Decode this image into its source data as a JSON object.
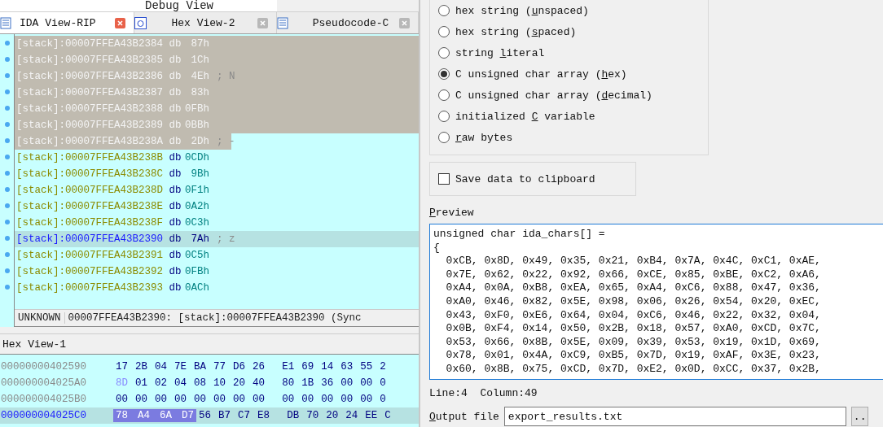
{
  "top_tab": {
    "label": "Debug View"
  },
  "tabs": [
    {
      "label": "IDA View-RIP",
      "selected": true
    },
    {
      "label": "Hex View-2",
      "selected": false
    },
    {
      "label": "Pseudocode-C",
      "selected": false
    }
  ],
  "disassembly": {
    "rows": [
      {
        "address": "[stack]:00007FFEA43B2384",
        "mnemonic": "db",
        "value": "87h",
        "selected": true,
        "current": false
      },
      {
        "address": "[stack]:00007FFEA43B2385",
        "mnemonic": "db",
        "value": "1Ch",
        "selected": true,
        "current": false
      },
      {
        "address": "[stack]:00007FFEA43B2386",
        "mnemonic": "db",
        "value": "4Eh",
        "comment": "; N",
        "comment_selected": true,
        "selected": true,
        "current": false
      },
      {
        "address": "[stack]:00007FFEA43B2387",
        "mnemonic": "db",
        "value": "83h",
        "selected": true,
        "current": false
      },
      {
        "address": "[stack]:00007FFEA43B2388",
        "mnemonic": "db",
        "value": "0FBh",
        "selected": true,
        "current": false
      },
      {
        "address": "[stack]:00007FFEA43B2389",
        "mnemonic": "db",
        "value": "0BBh",
        "selected": true,
        "current": false
      },
      {
        "address": "[stack]:00007FFEA43B238A",
        "mnemonic": "db",
        "value": "2Dh",
        "comment": "; -",
        "comment_selected": false,
        "selected": true,
        "current": false
      },
      {
        "address": "[stack]:00007FFEA43B238B",
        "mnemonic": "db",
        "value": "0CDh",
        "selected": false,
        "current": false
      },
      {
        "address": "[stack]:00007FFEA43B238C",
        "mnemonic": "db",
        "value": "9Bh",
        "selected": false,
        "current": false
      },
      {
        "address": "[stack]:00007FFEA43B238D",
        "mnemonic": "db",
        "value": "0F1h",
        "selected": false,
        "current": false
      },
      {
        "address": "[stack]:00007FFEA43B238E",
        "mnemonic": "db",
        "value": "0A2h",
        "selected": false,
        "current": false
      },
      {
        "address": "[stack]:00007FFEA43B238F",
        "mnemonic": "db",
        "value": "0C3h",
        "selected": false,
        "current": false
      },
      {
        "address": "[stack]:00007FFEA43B2390",
        "mnemonic": "db",
        "value": "7Ah",
        "comment": "; z",
        "selected": false,
        "current": true
      },
      {
        "address": "[stack]:00007FFEA43B2391",
        "mnemonic": "db",
        "value": "0C5h",
        "selected": false,
        "current": false
      },
      {
        "address": "[stack]:00007FFEA43B2392",
        "mnemonic": "db",
        "value": "0FBh",
        "selected": false,
        "current": false
      },
      {
        "address": "[stack]:00007FFEA43B2393",
        "mnemonic": "db",
        "value": "0ACh",
        "selected": false,
        "current": false
      }
    ],
    "status": {
      "type": "UNKNOWN",
      "location": "00007FFEA43B2390: [stack]:00007FFEA43B2390 (Sync"
    }
  },
  "hex_view": {
    "title": "Hex View-1",
    "rows": [
      {
        "address": "00000000402590",
        "current": false,
        "bytes": [
          {
            "text": "17",
            "changed": false,
            "selected": false
          },
          {
            "text": "2B",
            "changed": false,
            "selected": false
          },
          {
            "text": "04",
            "changed": false,
            "selected": false
          },
          {
            "text": "7E",
            "changed": false,
            "selected": false
          },
          {
            "text": "BA",
            "changed": false,
            "selected": false
          },
          {
            "text": "77",
            "changed": false,
            "selected": false
          },
          {
            "text": "D6",
            "changed": false,
            "selected": false
          },
          {
            "text": "26",
            "changed": false,
            "selected": false
          },
          {
            "text": "E1",
            "changed": false,
            "selected": false
          },
          {
            "text": "69",
            "changed": false,
            "selected": false
          },
          {
            "text": "14",
            "changed": false,
            "selected": false
          },
          {
            "text": "63",
            "changed": false,
            "selected": false
          },
          {
            "text": "55",
            "changed": false,
            "selected": false
          },
          {
            "text": "2",
            "changed": false,
            "selected": false
          }
        ]
      },
      {
        "address": "000000004025A0",
        "current": false,
        "bytes": [
          {
            "text": "8D",
            "changed": true,
            "selected": false
          },
          {
            "text": "01",
            "changed": false,
            "selected": false
          },
          {
            "text": "02",
            "changed": false,
            "selected": false
          },
          {
            "text": "04",
            "changed": false,
            "selected": false
          },
          {
            "text": "08",
            "changed": false,
            "selected": false
          },
          {
            "text": "10",
            "changed": false,
            "selected": false
          },
          {
            "text": "20",
            "changed": false,
            "selected": false
          },
          {
            "text": "40",
            "changed": false,
            "selected": false
          },
          {
            "text": "80",
            "changed": false,
            "selected": false
          },
          {
            "text": "1B",
            "changed": false,
            "selected": false
          },
          {
            "text": "36",
            "changed": false,
            "selected": false
          },
          {
            "text": "00",
            "changed": false,
            "selected": false
          },
          {
            "text": "00",
            "changed": false,
            "selected": false
          },
          {
            "text": "0",
            "changed": false,
            "selected": false
          }
        ]
      },
      {
        "address": "000000004025B0",
        "current": false,
        "bytes": [
          {
            "text": "00",
            "changed": false,
            "selected": false
          },
          {
            "text": "00",
            "changed": false,
            "selected": false
          },
          {
            "text": "00",
            "changed": false,
            "selected": false
          },
          {
            "text": "00",
            "changed": false,
            "selected": false
          },
          {
            "text": "00",
            "changed": false,
            "selected": false
          },
          {
            "text": "00",
            "changed": false,
            "selected": false
          },
          {
            "text": "00",
            "changed": false,
            "selected": false
          },
          {
            "text": "00",
            "changed": false,
            "selected": false
          },
          {
            "text": "00",
            "changed": false,
            "selected": false
          },
          {
            "text": "00",
            "changed": false,
            "selected": false
          },
          {
            "text": "00",
            "changed": false,
            "selected": false
          },
          {
            "text": "00",
            "changed": false,
            "selected": false
          },
          {
            "text": "00",
            "changed": false,
            "selected": false
          },
          {
            "text": "0",
            "changed": false,
            "selected": false
          }
        ]
      },
      {
        "address": "000000004025C0",
        "current": true,
        "bytes": [
          {
            "text": "78",
            "changed": false,
            "selected": true
          },
          {
            "text": "A4",
            "changed": false,
            "selected": true
          },
          {
            "text": "6A",
            "changed": false,
            "selected": true
          },
          {
            "text": "D7",
            "changed": false,
            "selected": true
          },
          {
            "text": "56",
            "changed": false,
            "selected": false
          },
          {
            "text": "B7",
            "changed": false,
            "selected": false
          },
          {
            "text": "C7",
            "changed": false,
            "selected": false
          },
          {
            "text": "E8",
            "changed": false,
            "selected": false
          },
          {
            "text": "DB",
            "changed": false,
            "selected": false
          },
          {
            "text": "70",
            "changed": false,
            "selected": false
          },
          {
            "text": "20",
            "changed": false,
            "selected": false
          },
          {
            "text": "24",
            "changed": false,
            "selected": false
          },
          {
            "text": "EE",
            "changed": false,
            "selected": false
          },
          {
            "text": "C",
            "changed": false,
            "selected": false
          }
        ]
      }
    ]
  },
  "export": {
    "formats": [
      {
        "before": "hex string (",
        "key": "u",
        "after": "nspaced)",
        "selected": false
      },
      {
        "before": "hex string (",
        "key": "s",
        "after": "paced)",
        "selected": false
      },
      {
        "before": "string ",
        "key": "l",
        "after": "iteral",
        "selected": false
      },
      {
        "before": "C unsigned char array (",
        "key": "h",
        "after": "ex)",
        "selected": true
      },
      {
        "before": "C unsigned char array (",
        "key": "d",
        "after": "ecimal)",
        "selected": false
      },
      {
        "before": "initialized ",
        "key": "C",
        "after": " variable",
        "selected": false
      },
      {
        "key": "r",
        "after": "aw bytes",
        "selected": false
      }
    ],
    "save_to_clipboard": {
      "label": "Save data to clipboard",
      "checked": false
    },
    "preview": {
      "label": {
        "key": "P",
        "after": "review"
      },
      "lines": [
        "unsigned char ida_chars[] =",
        "{",
        "  0xCB, 0x8D, 0x49, 0x35, 0x21, 0xB4, 0x7A, 0x4C, 0xC1, 0xAE,",
        "  0x7E, 0x62, 0x22, 0x92, 0x66, 0xCE, 0x85, 0xBE, 0xC2, 0xA6,",
        "  0xA4, 0x0A, 0xB8, 0xEA, 0x65, 0xA4, 0xC6, 0x88, 0x47, 0x36,",
        "  0xA0, 0x46, 0x82, 0x5E, 0x98, 0x06, 0x26, 0x54, 0x20, 0xEC,",
        "  0x43, 0xF0, 0xE6, 0x64, 0x04, 0xC6, 0x46, 0x22, 0x32, 0x04,",
        "  0x0B, 0xF4, 0x14, 0x50, 0x2B, 0x18, 0x57, 0xA0, 0xCD, 0x7C,",
        "  0x53, 0x66, 0x8B, 0x5E, 0x09, 0x39, 0x53, 0x19, 0x1D, 0x69,",
        "  0x78, 0x01, 0x4A, 0xC9, 0xB5, 0x7D, 0x19, 0xAF, 0x3E, 0x23,",
        "  0x60, 0x8B, 0x75, 0xCD, 0x7D, 0xE2, 0x0D, 0xCC, 0x37, 0x2B,"
      ]
    },
    "cursor": {
      "line": "Line:4",
      "column": "Column:49"
    },
    "output_file": {
      "label": {
        "key": "O",
        "after": "utput file"
      },
      "value": "export_results.txt",
      "browse": ".."
    }
  }
}
